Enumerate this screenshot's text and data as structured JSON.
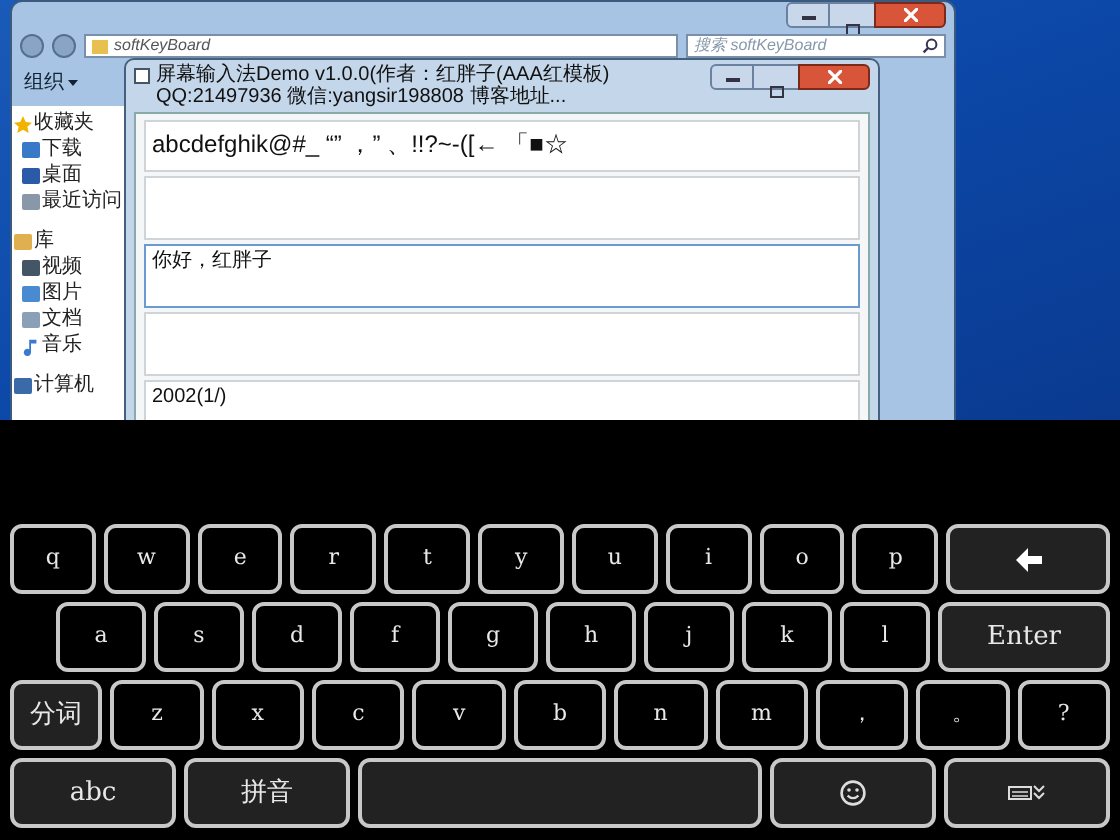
{
  "explorer": {
    "breadcrumb": "softKeyBoard",
    "search": {
      "placeholder": "搜索 softKeyBoard"
    },
    "toolbar": {
      "organize": "组织"
    },
    "sidebar": [
      {
        "label": "收藏夹",
        "children": [
          {
            "label": "下载"
          },
          {
            "label": "桌面"
          },
          {
            "label": "最近访问"
          }
        ]
      },
      {
        "label": "库",
        "children": [
          {
            "label": "视频"
          },
          {
            "label": "图片"
          },
          {
            "label": "文档"
          },
          {
            "label": "音乐"
          }
        ]
      },
      {
        "label": "计算机"
      }
    ]
  },
  "app": {
    "title": "屏幕输入法Demo v1.0.0(作者：红胖子(AAA红模板) QQ:21497936 微信:yangsir198808 博客地址...",
    "fields": [
      {
        "value": "abcdefghik@#_ “” ，” 、!!?~-([← 「■☆",
        "focused": false,
        "kind": "line"
      },
      {
        "focused": false,
        "kind": "box"
      },
      {
        "value": "你好，红胖子",
        "focused": true,
        "kind": "box"
      },
      {
        "focused": false,
        "kind": "box"
      },
      {
        "value": "2002(1/)",
        "focused": false,
        "kind": "box"
      }
    ]
  },
  "keyboard": {
    "rows": [
      [
        {
          "label": "q",
          "kind": "letter"
        },
        {
          "label": "w",
          "kind": "letter"
        },
        {
          "label": "e",
          "kind": "letter"
        },
        {
          "label": "r",
          "kind": "letter"
        },
        {
          "label": "t",
          "kind": "letter"
        },
        {
          "label": "y",
          "kind": "letter"
        },
        {
          "label": "u",
          "kind": "letter"
        },
        {
          "label": "i",
          "kind": "letter"
        },
        {
          "label": "o",
          "kind": "letter"
        },
        {
          "label": "p",
          "kind": "letter"
        },
        {
          "kind": "backspace"
        }
      ],
      [
        {
          "label": "a",
          "kind": "letter"
        },
        {
          "label": "s",
          "kind": "letter"
        },
        {
          "label": "d",
          "kind": "letter"
        },
        {
          "label": "f",
          "kind": "letter"
        },
        {
          "label": "g",
          "kind": "letter"
        },
        {
          "label": "h",
          "kind": "letter"
        },
        {
          "label": "j",
          "kind": "letter"
        },
        {
          "label": "k",
          "kind": "letter"
        },
        {
          "label": "l",
          "kind": "letter"
        },
        {
          "label": "Enter",
          "kind": "function"
        }
      ],
      [
        {
          "label": "分词",
          "kind": "mode"
        },
        {
          "label": "z",
          "kind": "letter"
        },
        {
          "label": "x",
          "kind": "letter"
        },
        {
          "label": "c",
          "kind": "letter"
        },
        {
          "label": "v",
          "kind": "letter"
        },
        {
          "label": "b",
          "kind": "letter"
        },
        {
          "label": "n",
          "kind": "letter"
        },
        {
          "label": "m",
          "kind": "letter"
        },
        {
          "label": "，",
          "kind": "letter"
        },
        {
          "label": "。",
          "kind": "letter"
        },
        {
          "label": "?",
          "kind": "letter"
        }
      ],
      [
        {
          "label": "abc",
          "kind": "function"
        },
        {
          "label": "拼音",
          "kind": "function"
        },
        {
          "kind": "space"
        },
        {
          "kind": "emoji"
        },
        {
          "kind": "hide"
        }
      ]
    ]
  }
}
